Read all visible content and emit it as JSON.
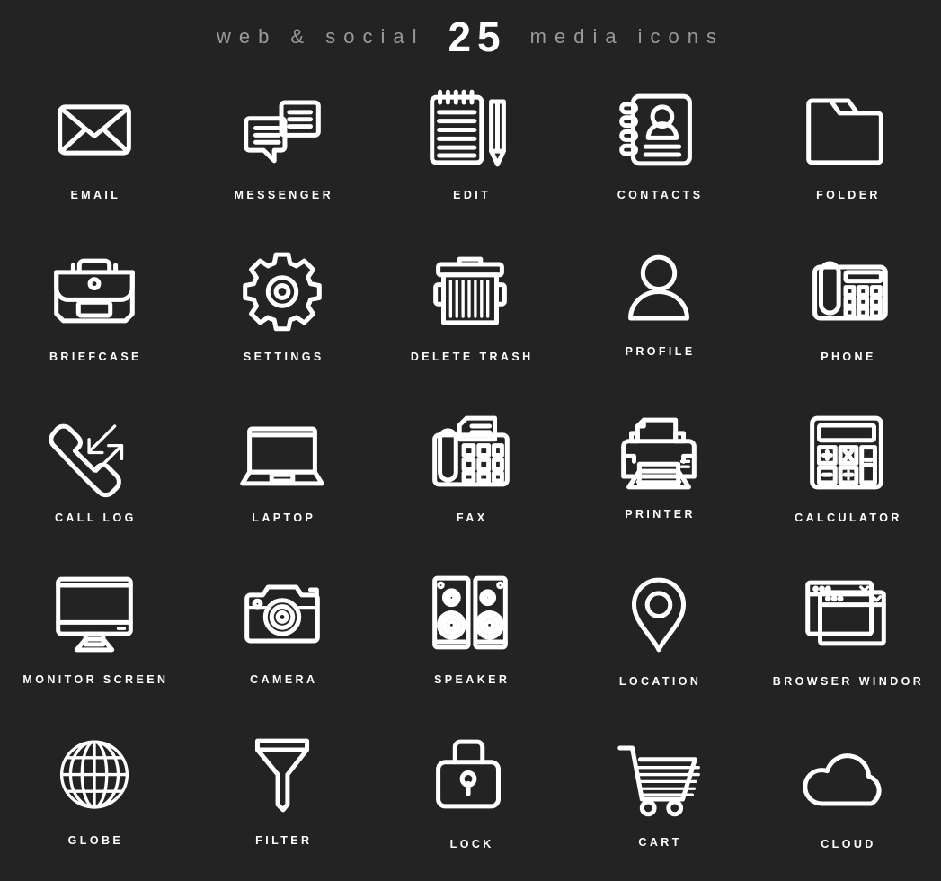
{
  "header": {
    "left_text": "web & social",
    "count": "25",
    "right_text": "media icons",
    "count_color": "#ffffff",
    "word_color": "#9a9a9a"
  },
  "theme": {
    "background": "#232323",
    "icon_stroke": "#ffffff",
    "label_color": "#ffffff"
  },
  "grid": {
    "columns": 5,
    "rows": 5,
    "total_icons": 25
  },
  "icons": [
    {
      "label": "EMAIL",
      "icon": "envelope-icon",
      "row": 1,
      "col": 1
    },
    {
      "label": "MESSENGER",
      "icon": "chat-bubbles-icon",
      "row": 1,
      "col": 2
    },
    {
      "label": "EDIT",
      "icon": "notepad-pencil-icon",
      "row": 1,
      "col": 3
    },
    {
      "label": "CONTACTS",
      "icon": "address-book-icon",
      "row": 1,
      "col": 4
    },
    {
      "label": "FOLDER",
      "icon": "folder-icon",
      "row": 1,
      "col": 5
    },
    {
      "label": "BRIEFCASE",
      "icon": "briefcase-icon",
      "row": 2,
      "col": 1
    },
    {
      "label": "SETTINGS",
      "icon": "gear-icon",
      "row": 2,
      "col": 2
    },
    {
      "label": "DELETE TRASH",
      "icon": "trash-can-icon",
      "row": 2,
      "col": 3
    },
    {
      "label": "PROFILE",
      "icon": "user-icon",
      "row": 2,
      "col": 4
    },
    {
      "label": "PHONE",
      "icon": "desk-phone-icon",
      "row": 2,
      "col": 5
    },
    {
      "label": "CALL LOG",
      "icon": "call-log-icon",
      "row": 3,
      "col": 1
    },
    {
      "label": "LAPTOP",
      "icon": "laptop-icon",
      "row": 3,
      "col": 2
    },
    {
      "label": "FAX",
      "icon": "fax-machine-icon",
      "row": 3,
      "col": 3
    },
    {
      "label": "PRINTER",
      "icon": "printer-icon",
      "row": 3,
      "col": 4
    },
    {
      "label": "CALCULATOR",
      "icon": "calculator-icon",
      "row": 3,
      "col": 5
    },
    {
      "label": "MONITOR SCREEN",
      "icon": "monitor-icon",
      "row": 4,
      "col": 1
    },
    {
      "label": "CAMERA",
      "icon": "camera-icon",
      "row": 4,
      "col": 2
    },
    {
      "label": "SPEAKER",
      "icon": "speakers-icon",
      "row": 4,
      "col": 3
    },
    {
      "label": "LOCATION",
      "icon": "map-pin-icon",
      "row": 4,
      "col": 4
    },
    {
      "label": "BROWSER WINDOR",
      "icon": "browser-windows-icon",
      "row": 4,
      "col": 5
    },
    {
      "label": "GLOBE",
      "icon": "globe-icon",
      "row": 5,
      "col": 1
    },
    {
      "label": "FILTER",
      "icon": "funnel-icon",
      "row": 5,
      "col": 2
    },
    {
      "label": "LOCK",
      "icon": "padlock-icon",
      "row": 5,
      "col": 3
    },
    {
      "label": "CART",
      "icon": "shopping-cart-icon",
      "row": 5,
      "col": 4
    },
    {
      "label": "CLOUD",
      "icon": "cloud-icon",
      "row": 5,
      "col": 5
    }
  ]
}
